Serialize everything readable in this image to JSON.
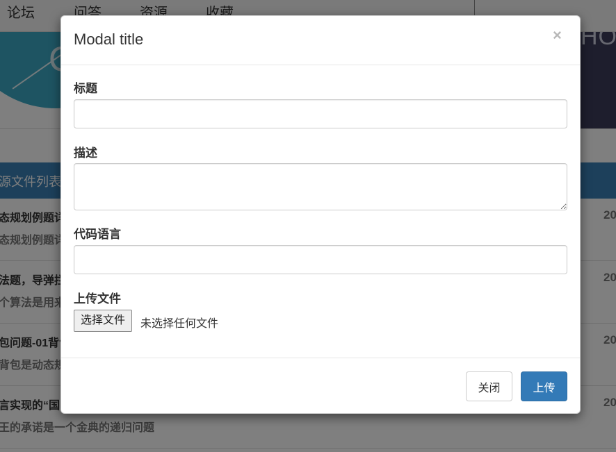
{
  "background": {
    "nav_items": [
      "论坛",
      "问答",
      "资源",
      "收藏"
    ],
    "banner_letter": "C",
    "banner_right_text": "HO",
    "list_header": "源文件列表",
    "rows": [
      {
        "title": "态规划例题详",
        "desc": "态规划例题详",
        "year": "20"
      },
      {
        "title": "法题，导弹拦",
        "desc": "个算法是用来",
        "year": "20"
      },
      {
        "title": "包问题-01背包",
        "desc": "背包是动态规",
        "year": "20"
      },
      {
        "title": "言实现的“国",
        "desc": "王的承诺是一个金典的递归问题",
        "year": "20"
      }
    ]
  },
  "modal": {
    "title": "Modal title",
    "close_symbol": "×",
    "fields": {
      "title_label": "标题",
      "title_value": "",
      "description_label": "描述",
      "description_value": "",
      "language_label": "代码语言",
      "language_value": "",
      "upload_label": "上传文件",
      "choose_file_button": "选择文件",
      "no_file_text": "未选择任何文件"
    },
    "footer": {
      "close_button": "关闭",
      "upload_button": "上传"
    }
  },
  "colors": {
    "primary": "#337ab7",
    "list_header_bg": "#3a80b7",
    "backdrop": "rgba(0,0,0,0.5)"
  }
}
